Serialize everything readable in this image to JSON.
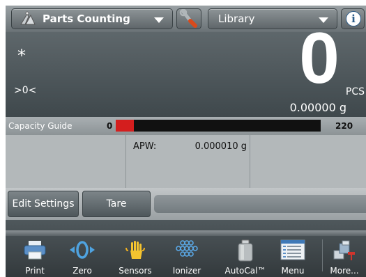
{
  "topbar": {
    "application": "Parts Counting",
    "library": "Library",
    "info_glyph": "i"
  },
  "display": {
    "stable_indicator": "*",
    "center_of_zero": ">0<",
    "main_value": "0",
    "main_unit": "PCS",
    "secondary_value": "0.00000 g"
  },
  "capacity_guide": {
    "label": "Capacity Guide",
    "min": "0",
    "max": "220",
    "fill_fraction": 0.09,
    "fill_color": "#d41e1e"
  },
  "reference": {
    "apw_label": "APW:",
    "apw_value": "0.000010 g"
  },
  "actions": {
    "edit_settings": "Edit Settings",
    "tare": "Tare"
  },
  "nav": [
    {
      "label": "Print",
      "icon": "printer-icon"
    },
    {
      "label": "Zero",
      "icon": "zero-icon"
    },
    {
      "label": "Sensors",
      "icon": "hand-sensor-icon"
    },
    {
      "label": "Ionizer",
      "icon": "ionizer-icon"
    },
    {
      "label": "AutoCal™",
      "icon": "calibration-weight-icon"
    },
    {
      "label": "Menu",
      "icon": "menu-icon"
    },
    {
      "label": "More...",
      "icon": "more-icon"
    }
  ]
}
